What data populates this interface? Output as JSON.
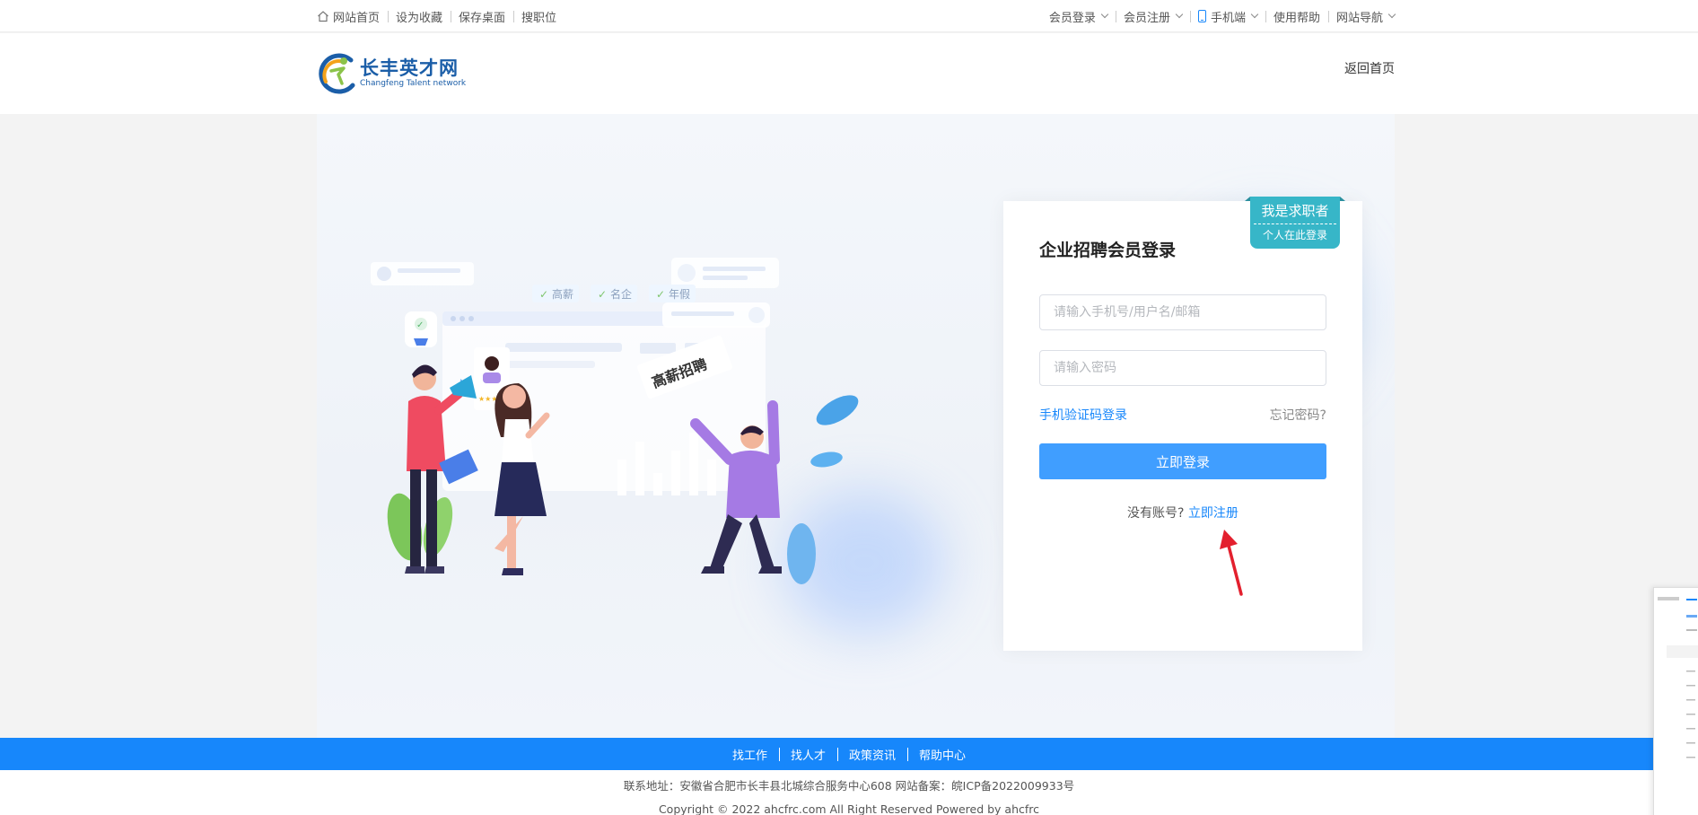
{
  "topbar": {
    "left": [
      {
        "label": "网站首页",
        "icon": "home-icon"
      },
      {
        "label": "设为收藏"
      },
      {
        "label": "保存桌面"
      },
      {
        "label": "搜职位"
      }
    ],
    "right": [
      {
        "label": "会员登录"
      },
      {
        "label": "会员注册"
      },
      {
        "label": "手机端",
        "icon": "phone-icon"
      },
      {
        "label": "使用帮助"
      },
      {
        "label": "网站导航"
      }
    ]
  },
  "header": {
    "logo_cn": "长丰英才网",
    "logo_en": "Changfeng Talent network",
    "back_home": "返回首页"
  },
  "illustration": {
    "tags": [
      "高薪",
      "名企",
      "年假"
    ],
    "sign": "高薪招聘"
  },
  "login": {
    "title": "企业招聘会员登录",
    "seeker_main": "我是求职者",
    "seeker_sub": "个人在此登录",
    "username_placeholder": "请输入手机号/用户名/邮箱",
    "password_placeholder": "请输入密码",
    "sms_login": "手机验证码登录",
    "forgot": "忘记密码?",
    "submit": "立即登录",
    "no_account": "没有账号?",
    "register": "立即注册"
  },
  "footer": {
    "nav": [
      "找工作",
      "找人才",
      "政策资讯",
      "帮助中心"
    ],
    "address": "联系地址：安徽省合肥市长丰县北城综合服务中心608 网站备案：皖ICP备2022009933号",
    "copyright": "Copyright © 2022 ahcfrc.com All Right Reserved Powered by ahcfrc"
  },
  "colors": {
    "accent": "#1787fb",
    "button": "#409eff",
    "seeker_tag": "#37b6c8",
    "arrow": "#e3202e"
  }
}
